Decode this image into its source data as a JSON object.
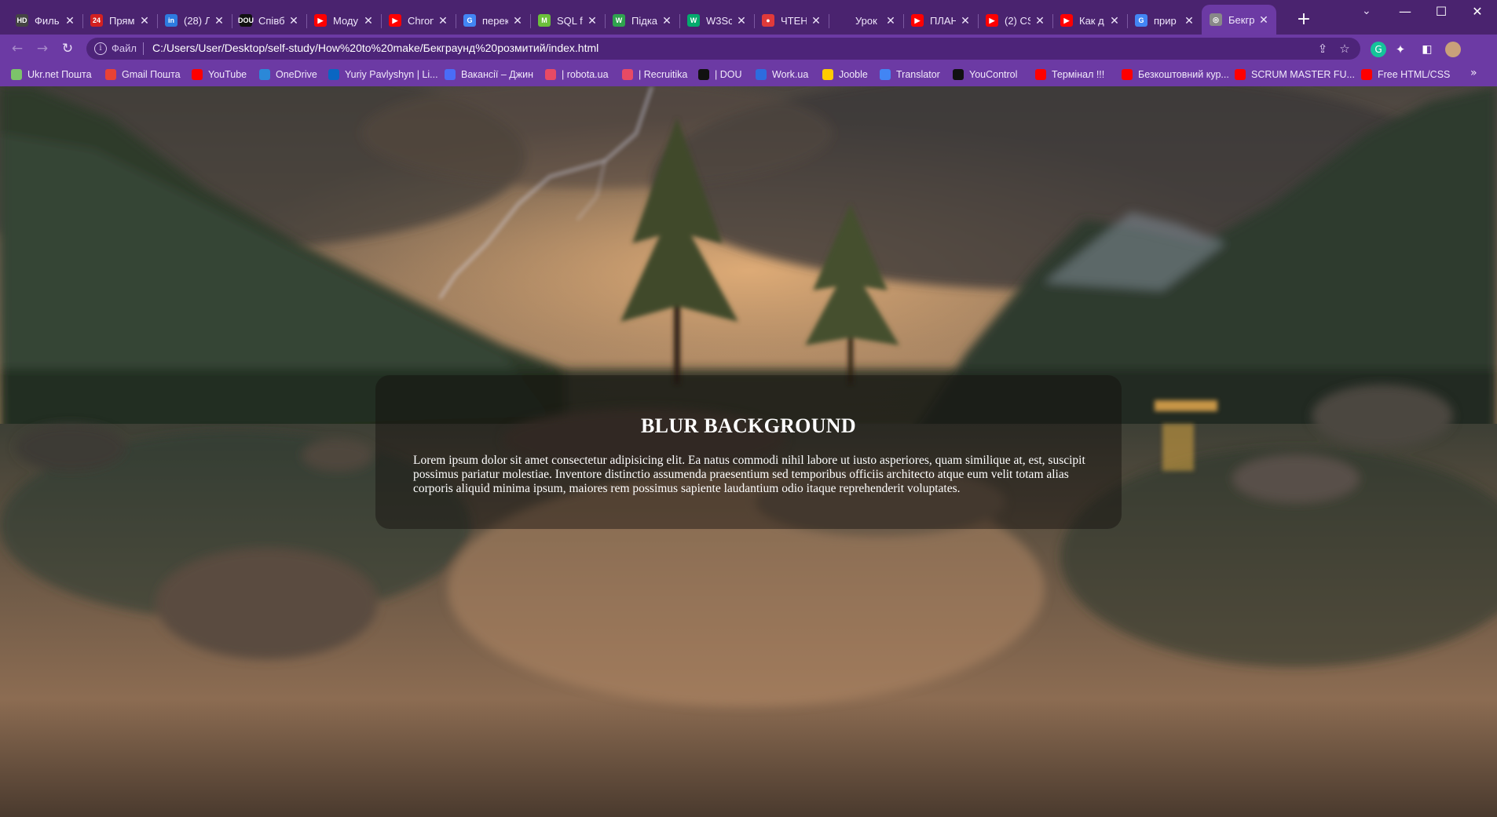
{
  "browser": {
    "tabs": [
      {
        "title": "Филь",
        "icon": "hd-icon"
      },
      {
        "title": "Прям",
        "icon": "24-icon"
      },
      {
        "title": "(28) Л",
        "icon": "linkedin-circle-icon"
      },
      {
        "title": "Співб",
        "icon": "dou-icon"
      },
      {
        "title": "Моду",
        "icon": "youtube-icon"
      },
      {
        "title": "Chron",
        "icon": "youtube-icon"
      },
      {
        "title": "перек",
        "icon": "google-icon"
      },
      {
        "title": "SQL fo",
        "icon": "m-icon"
      },
      {
        "title": "Підка",
        "icon": "w-icon"
      },
      {
        "title": "W3Sc",
        "icon": "w3-icon"
      },
      {
        "title": "ЧТЕНІ",
        "icon": "chrome-red-icon"
      },
      {
        "title": "Урок",
        "icon": "blank-icon"
      },
      {
        "title": "ПЛАН",
        "icon": "youtube-icon"
      },
      {
        "title": "(2) CS",
        "icon": "youtube-icon"
      },
      {
        "title": "Как д",
        "icon": "youtube-icon"
      },
      {
        "title": "прир",
        "icon": "google-icon"
      },
      {
        "title": "Бекгр",
        "icon": "globe-icon",
        "active": true
      }
    ],
    "new_tab": "+",
    "tab_search": "⌄",
    "window_controls": {
      "minimize": "—",
      "maximize": "☐",
      "close": "✕"
    },
    "nav": {
      "back": "←",
      "forward": "→",
      "reload": "↻"
    },
    "address": {
      "scheme_label": "Файл",
      "url": "C:/Users/User/Desktop/self-study/How%20to%20make/Бекграунд%20розмитий/index.html"
    },
    "bookmarks": [
      {
        "label": "Ukr.net Пошта",
        "color": "#7cc36a"
      },
      {
        "label": "Gmail Пошта",
        "color": "#e94235"
      },
      {
        "label": "YouTube",
        "color": "#ff0000"
      },
      {
        "label": "OneDrive",
        "color": "#2b88d8"
      },
      {
        "label": "Yuriy Pavlyshyn | Li...",
        "color": "#0a66c2"
      },
      {
        "label": "Вакансії – Джин",
        "color": "#4a6cf7"
      },
      {
        "label": "| robota.ua",
        "color": "#e84a64"
      },
      {
        "label": "| Recruitika",
        "color": "#e84a64"
      },
      {
        "label": "| DOU",
        "color": "#111111"
      },
      {
        "label": "Work.ua",
        "color": "#2d6cdf"
      },
      {
        "label": "Jooble",
        "color": "#ffcc00"
      },
      {
        "label": "Translator",
        "color": "#4285f4"
      },
      {
        "label": "YouControl",
        "color": "#111111"
      },
      {
        "label": "Термінал !!!",
        "color": "#ff0000"
      },
      {
        "label": "Безкоштовний кур...",
        "color": "#ff0000"
      },
      {
        "label": "SCRUM MASTER FU...",
        "color": "#ff0000"
      },
      {
        "label": "Free HTML/CSS",
        "color": "#ff0000"
      }
    ],
    "bookmarks_more": "»"
  },
  "page": {
    "heading": "BLUR BACKGROUND",
    "body": "Lorem ipsum dolor sit amet consectetur adipisicing elit. Ea natus commodi nihil labore ut iusto asperiores, quam similique at, est, suscipit possimus pariatur molestiae. Inventore distinctio assumenda praesentium sed temporibus officiis architecto atque eum velit totam alias corporis aliquid minima ipsum, maiores rem possimus sapiente laudantium odio itaque reprehenderit voluptates."
  }
}
